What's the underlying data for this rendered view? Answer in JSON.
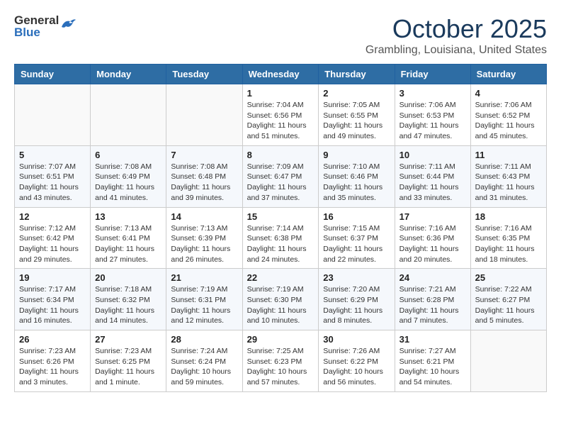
{
  "header": {
    "logo_general": "General",
    "logo_blue": "Blue",
    "month_title": "October 2025",
    "subtitle": "Grambling, Louisiana, United States"
  },
  "days_of_week": [
    "Sunday",
    "Monday",
    "Tuesday",
    "Wednesday",
    "Thursday",
    "Friday",
    "Saturday"
  ],
  "weeks": [
    [
      {
        "day": "",
        "info": ""
      },
      {
        "day": "",
        "info": ""
      },
      {
        "day": "",
        "info": ""
      },
      {
        "day": "1",
        "info": "Sunrise: 7:04 AM\nSunset: 6:56 PM\nDaylight: 11 hours\nand 51 minutes."
      },
      {
        "day": "2",
        "info": "Sunrise: 7:05 AM\nSunset: 6:55 PM\nDaylight: 11 hours\nand 49 minutes."
      },
      {
        "day": "3",
        "info": "Sunrise: 7:06 AM\nSunset: 6:53 PM\nDaylight: 11 hours\nand 47 minutes."
      },
      {
        "day": "4",
        "info": "Sunrise: 7:06 AM\nSunset: 6:52 PM\nDaylight: 11 hours\nand 45 minutes."
      }
    ],
    [
      {
        "day": "5",
        "info": "Sunrise: 7:07 AM\nSunset: 6:51 PM\nDaylight: 11 hours\nand 43 minutes."
      },
      {
        "day": "6",
        "info": "Sunrise: 7:08 AM\nSunset: 6:49 PM\nDaylight: 11 hours\nand 41 minutes."
      },
      {
        "day": "7",
        "info": "Sunrise: 7:08 AM\nSunset: 6:48 PM\nDaylight: 11 hours\nand 39 minutes."
      },
      {
        "day": "8",
        "info": "Sunrise: 7:09 AM\nSunset: 6:47 PM\nDaylight: 11 hours\nand 37 minutes."
      },
      {
        "day": "9",
        "info": "Sunrise: 7:10 AM\nSunset: 6:46 PM\nDaylight: 11 hours\nand 35 minutes."
      },
      {
        "day": "10",
        "info": "Sunrise: 7:11 AM\nSunset: 6:44 PM\nDaylight: 11 hours\nand 33 minutes."
      },
      {
        "day": "11",
        "info": "Sunrise: 7:11 AM\nSunset: 6:43 PM\nDaylight: 11 hours\nand 31 minutes."
      }
    ],
    [
      {
        "day": "12",
        "info": "Sunrise: 7:12 AM\nSunset: 6:42 PM\nDaylight: 11 hours\nand 29 minutes."
      },
      {
        "day": "13",
        "info": "Sunrise: 7:13 AM\nSunset: 6:41 PM\nDaylight: 11 hours\nand 27 minutes."
      },
      {
        "day": "14",
        "info": "Sunrise: 7:13 AM\nSunset: 6:39 PM\nDaylight: 11 hours\nand 26 minutes."
      },
      {
        "day": "15",
        "info": "Sunrise: 7:14 AM\nSunset: 6:38 PM\nDaylight: 11 hours\nand 24 minutes."
      },
      {
        "day": "16",
        "info": "Sunrise: 7:15 AM\nSunset: 6:37 PM\nDaylight: 11 hours\nand 22 minutes."
      },
      {
        "day": "17",
        "info": "Sunrise: 7:16 AM\nSunset: 6:36 PM\nDaylight: 11 hours\nand 20 minutes."
      },
      {
        "day": "18",
        "info": "Sunrise: 7:16 AM\nSunset: 6:35 PM\nDaylight: 11 hours\nand 18 minutes."
      }
    ],
    [
      {
        "day": "19",
        "info": "Sunrise: 7:17 AM\nSunset: 6:34 PM\nDaylight: 11 hours\nand 16 minutes."
      },
      {
        "day": "20",
        "info": "Sunrise: 7:18 AM\nSunset: 6:32 PM\nDaylight: 11 hours\nand 14 minutes."
      },
      {
        "day": "21",
        "info": "Sunrise: 7:19 AM\nSunset: 6:31 PM\nDaylight: 11 hours\nand 12 minutes."
      },
      {
        "day": "22",
        "info": "Sunrise: 7:19 AM\nSunset: 6:30 PM\nDaylight: 11 hours\nand 10 minutes."
      },
      {
        "day": "23",
        "info": "Sunrise: 7:20 AM\nSunset: 6:29 PM\nDaylight: 11 hours\nand 8 minutes."
      },
      {
        "day": "24",
        "info": "Sunrise: 7:21 AM\nSunset: 6:28 PM\nDaylight: 11 hours\nand 7 minutes."
      },
      {
        "day": "25",
        "info": "Sunrise: 7:22 AM\nSunset: 6:27 PM\nDaylight: 11 hours\nand 5 minutes."
      }
    ],
    [
      {
        "day": "26",
        "info": "Sunrise: 7:23 AM\nSunset: 6:26 PM\nDaylight: 11 hours\nand 3 minutes."
      },
      {
        "day": "27",
        "info": "Sunrise: 7:23 AM\nSunset: 6:25 PM\nDaylight: 11 hours\nand 1 minute."
      },
      {
        "day": "28",
        "info": "Sunrise: 7:24 AM\nSunset: 6:24 PM\nDaylight: 10 hours\nand 59 minutes."
      },
      {
        "day": "29",
        "info": "Sunrise: 7:25 AM\nSunset: 6:23 PM\nDaylight: 10 hours\nand 57 minutes."
      },
      {
        "day": "30",
        "info": "Sunrise: 7:26 AM\nSunset: 6:22 PM\nDaylight: 10 hours\nand 56 minutes."
      },
      {
        "day": "31",
        "info": "Sunrise: 7:27 AM\nSunset: 6:21 PM\nDaylight: 10 hours\nand 54 minutes."
      },
      {
        "day": "",
        "info": ""
      }
    ]
  ]
}
